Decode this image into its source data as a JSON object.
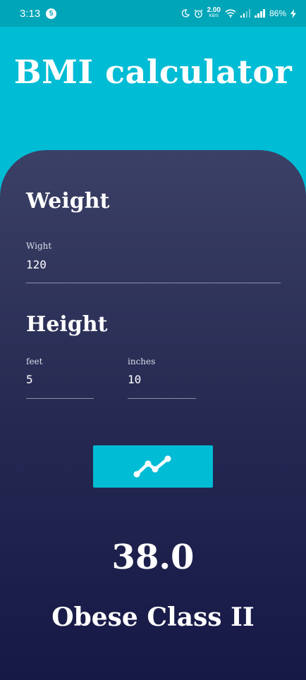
{
  "status_bar": {
    "time": "3:13",
    "notification_count": "5",
    "net_speed": "2.00",
    "net_speed_unit": "KB/S",
    "battery": "86%"
  },
  "app": {
    "title": "BMI calculator"
  },
  "weight": {
    "heading": "Weight",
    "label": "Wight",
    "value": "120"
  },
  "height": {
    "heading": "Height",
    "feet_label": "feet",
    "feet_value": "5",
    "inches_label": "inches",
    "inches_value": "10"
  },
  "calculate_button": {
    "icon": "trending-up-icon"
  },
  "result": {
    "bmi": "38.0",
    "category": "Obese Class II"
  },
  "colors": {
    "accent": "#00BCD4",
    "status_bar": "#00A5B8",
    "panel_top": "#3B4066",
    "panel_bottom": "#161846"
  }
}
